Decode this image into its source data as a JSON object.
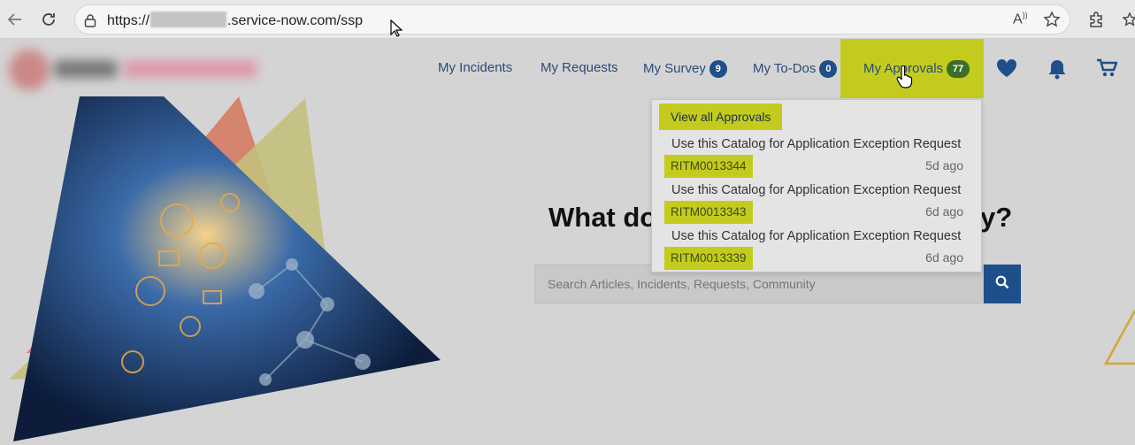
{
  "browser": {
    "url_prefix": "https://",
    "url_suffix": ".service-now.com/ssp"
  },
  "nav": {
    "incidents": "My Incidents",
    "requests": "My Requests",
    "survey": "My Survey",
    "survey_count": "9",
    "todos": "My To-Dos",
    "todos_count": "0",
    "approvals": "My Approvals",
    "approvals_count": "77"
  },
  "hero": {
    "title_left": "What do",
    "title_right": "y?",
    "search_placeholder": "Search Articles, Incidents, Requests, Community"
  },
  "dropdown": {
    "view_all": "View all Approvals",
    "items": [
      {
        "title": "Use this Catalog for Application Exception Request",
        "number": "RITM0013344",
        "time": "5d ago"
      },
      {
        "title": "Use this Catalog for Application Exception Request",
        "number": "RITM0013343",
        "time": "6d ago"
      },
      {
        "title": "Use this Catalog for Application Exception Request",
        "number": "RITM0013339",
        "time": "6d ago"
      }
    ]
  },
  "colors": {
    "highlight": "#c3cc1e",
    "brand_blue": "#1f4f8a",
    "badge_green": "#3a6e2a",
    "nav_text": "#2c4a78"
  },
  "icons": [
    "back-icon",
    "reload-icon",
    "lock-icon",
    "read-aloud-icon",
    "favorite-star-icon",
    "extensions-icon",
    "heart-icon",
    "bell-icon",
    "cart-icon",
    "search-icon",
    "cursor-hand-icon"
  ]
}
